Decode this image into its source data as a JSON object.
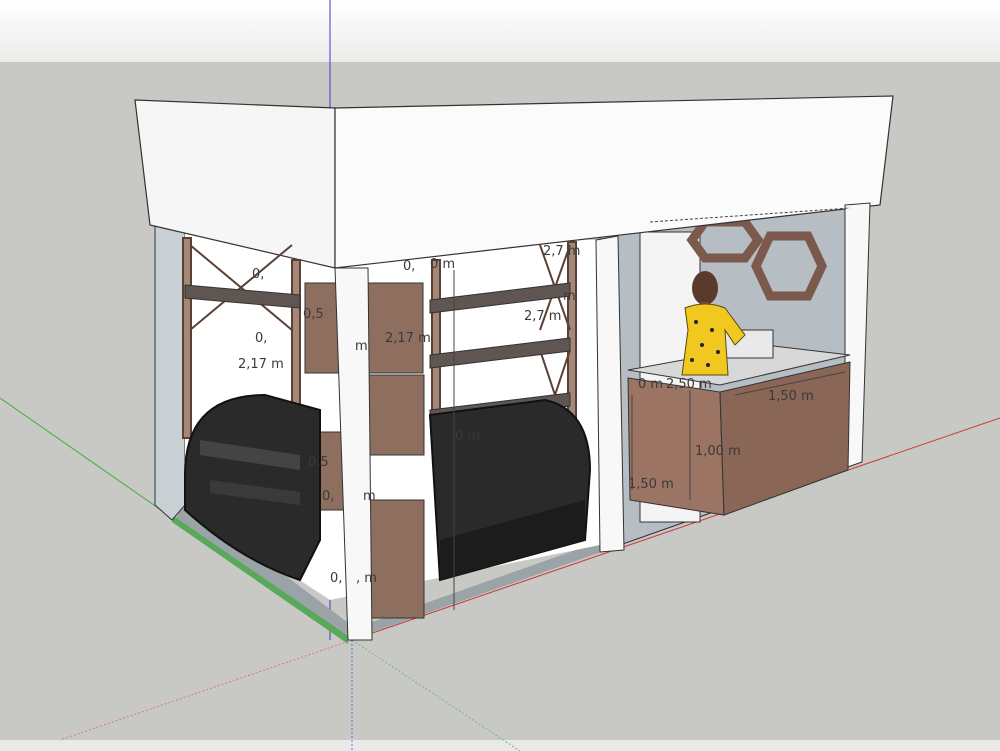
{
  "scene": {
    "colors": {
      "sky_top": "#ffffff",
      "sky_bottom": "#ececeb",
      "ground": "#c8c8c5",
      "wall_white": "#f6f6f6",
      "wood": "#8e6f5f",
      "counter_front": "#9b7464",
      "back_wall": "#b7bec3",
      "axis_red": "#cc3b3b",
      "axis_green": "#3fae3f",
      "axis_blue": "#3a3ad0",
      "dress_yellow": "#f0c820"
    }
  },
  "dimensions": {
    "d01": "0,",
    "d02": "0,",
    "d03": "2,7 m",
    "d04": "0,5",
    "d05": "2,17 m",
    "d06": "0,",
    "d07": "m",
    "d08": "2,17 m",
    "d09": "2,7 m",
    "d10": "0,5",
    "d11": "0,",
    "d12": "m",
    "d13": "0,",
    "d14": ", m",
    "d15": "0 m",
    "d16": "0 m",
    "d17": "2,50 m",
    "d18": "1,50 m",
    "d19": "1,00 m",
    "d20": "1,50 m",
    "d21": "0 m",
    "d22": "m"
  }
}
